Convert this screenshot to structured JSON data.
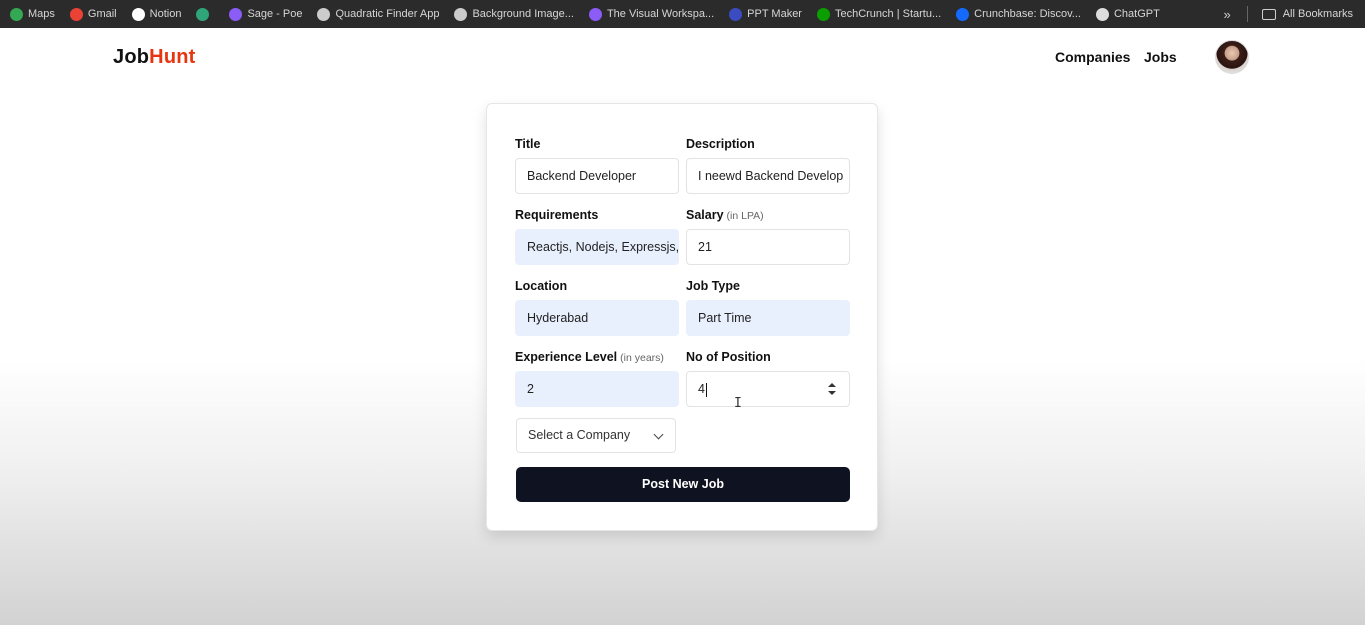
{
  "bookmarks": [
    {
      "label": "Maps",
      "icon": "maps-pin-icon",
      "color": "#34a853"
    },
    {
      "label": "Gmail",
      "icon": "gmail-icon",
      "color": "#ea4335"
    },
    {
      "label": "Notion",
      "icon": "notion-icon",
      "color": "#ffffff"
    },
    {
      "label": "",
      "icon": "app-icon",
      "color": "#2fa57a"
    },
    {
      "label": "Sage - Poe",
      "icon": "poe-icon",
      "color": "#8b5cf6"
    },
    {
      "label": "Quadratic Finder App",
      "icon": "globe-icon",
      "color": "#cccccc"
    },
    {
      "label": "Background Image...",
      "icon": "globe-icon",
      "color": "#cccccc"
    },
    {
      "label": "The Visual Workspa...",
      "icon": "workspace-icon",
      "color": "#8b5cf6"
    },
    {
      "label": "PPT Maker",
      "icon": "ppt-icon",
      "color": "#3b4cc0"
    },
    {
      "label": "TechCrunch | Startu...",
      "icon": "techcrunch-icon",
      "color": "#0a9e01"
    },
    {
      "label": "Crunchbase: Discov...",
      "icon": "crunchbase-icon",
      "color": "#146aff"
    },
    {
      "label": "ChatGPT",
      "icon": "chatgpt-icon",
      "color": "#dddddd"
    }
  ],
  "bookmarks_more": "»",
  "all_bookmarks": "All Bookmarks",
  "brand": {
    "part1": "Job",
    "part2": "Hunt",
    "accent": "#e8350f"
  },
  "nav": {
    "companies": "Companies",
    "jobs": "Jobs"
  },
  "form": {
    "title": {
      "label": "Title",
      "value": "Backend Developer"
    },
    "description": {
      "label": "Description",
      "value": "I neewd Backend Develop"
    },
    "requirements": {
      "label": "Requirements",
      "value": "Reactjs, Nodejs, Expressjs,"
    },
    "salary": {
      "label": "Salary",
      "hint": "(in LPA)",
      "value": "21"
    },
    "location": {
      "label": "Location",
      "value": "Hyderabad"
    },
    "job_type": {
      "label": "Job Type",
      "value": "Part Time"
    },
    "experience": {
      "label": "Experience Level",
      "hint": "(in years)",
      "value": "2"
    },
    "positions": {
      "label": "No of Position",
      "value": "4"
    },
    "company_select": {
      "placeholder": "Select a Company"
    },
    "submit_label": "Post New Job"
  }
}
